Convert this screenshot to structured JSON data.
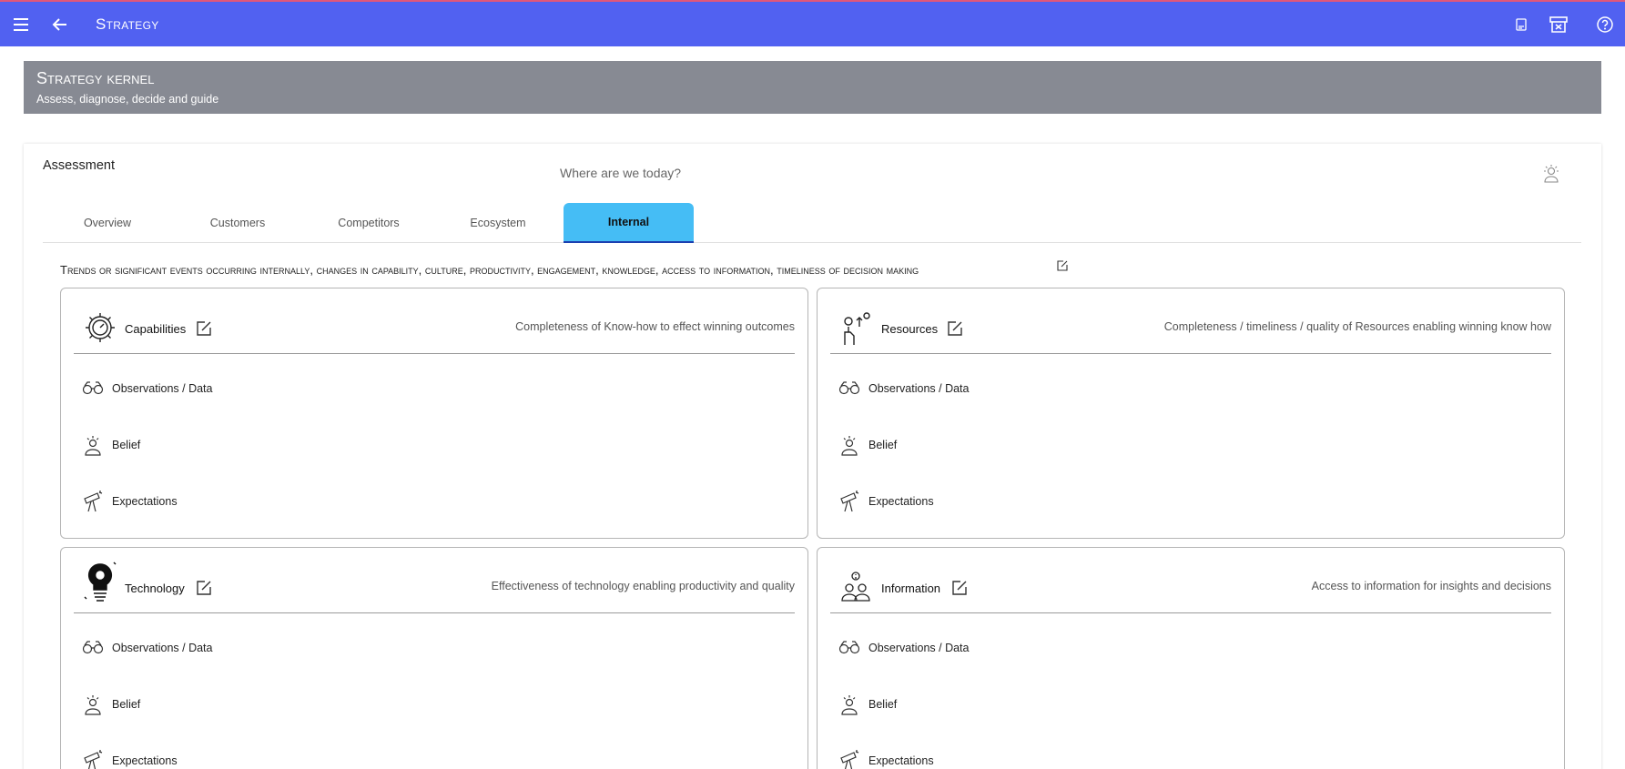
{
  "app": {
    "title": "Strategy",
    "menu_icon": "menu-icon",
    "back_icon": "arrow-back-icon",
    "right_icons": [
      "document-icon",
      "archive-icon",
      "help-icon"
    ],
    "bar_color": "#5161f1"
  },
  "banner": {
    "title": "Strategy kernel",
    "subtitle": "Assess, diagnose, decide and guide",
    "color": "#878a93"
  },
  "assessment": {
    "heading": "Assessment",
    "subheading": "Where are we today?",
    "icon": "lightbulb-person-icon",
    "tabs": [
      {
        "label": "Overview",
        "active": false
      },
      {
        "label": "Customers",
        "active": false
      },
      {
        "label": "Competitors",
        "active": false
      },
      {
        "label": "Ecosystem",
        "active": false
      },
      {
        "label": "Internal",
        "active": true
      }
    ],
    "active_tab_color": "#45bdf5",
    "trend_text": "Trends or significant events occurring internally, changes in capability, culture, productivity, engagement, knowledge, access to information, timeliness of decision making",
    "panels": [
      {
        "title": "Capabilities",
        "description": "Completeness of Know-how to effect winning outcomes",
        "icon": "gear-gauge-icon",
        "rows": [
          "Observations / Data",
          "Belief",
          "Expectations"
        ]
      },
      {
        "title": "Resources",
        "description": "Completeness / timeliness / quality of Resources enabling winning know how",
        "icon": "hand-resources-icon",
        "rows": [
          "Observations / Data",
          "Belief",
          "Expectations"
        ]
      },
      {
        "title": "Technology",
        "description": "Effectiveness of technology enabling productivity and quality",
        "icon": "tech-bulb-icon",
        "rows": [
          "Observations / Data",
          "Belief",
          "Expectations"
        ]
      },
      {
        "title": "Information",
        "description": "Access to information for insights and decisions",
        "icon": "people-info-icon",
        "rows": [
          "Observations / Data",
          "Belief",
          "Expectations"
        ]
      }
    ],
    "row_icons": [
      "binoculars-icon",
      "belief-person-icon",
      "telescope-icon"
    ]
  }
}
